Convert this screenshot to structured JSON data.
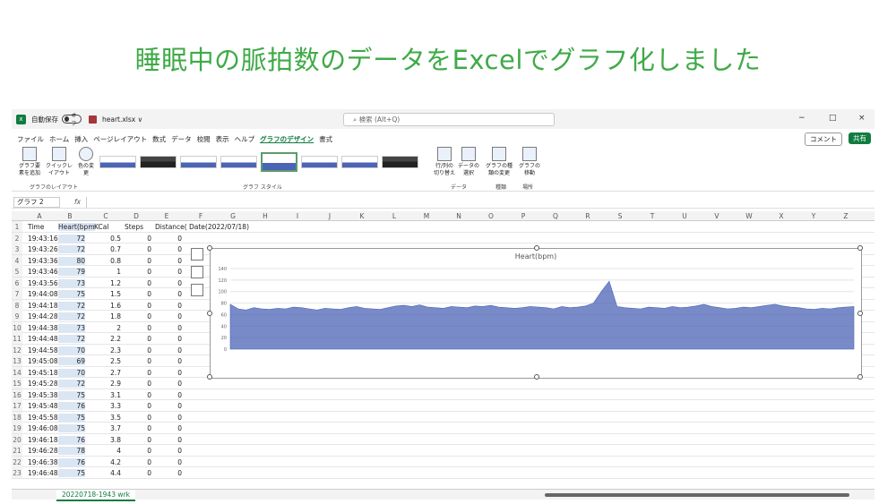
{
  "heading": "睡眠中の脈拍数のデータをExcelでグラフ化しました",
  "titlebar": {
    "autosave": "自動保存",
    "toggle": "オフ",
    "filename": "heart.xlsx ∨",
    "search": "検索 (Alt+Q)",
    "minimize": "−",
    "maximize": "□",
    "close": "×"
  },
  "menu": [
    "ファイル",
    "ホーム",
    "挿入",
    "ページレイアウト",
    "数式",
    "データ",
    "校閲",
    "表示",
    "ヘルプ",
    "グラフのデザイン",
    "書式"
  ],
  "buttons": {
    "comment": "コメント",
    "share": "共有"
  },
  "ribbon": {
    "add_element": "グラフ要素を追加",
    "quick_layout": "クイックレイアウト",
    "colors": "色の変更",
    "group_layout": "グラフのレイアウト",
    "group_style": "グラフ スタイル",
    "switch": "行/列の切り替え",
    "select_data": "データの選択",
    "group_data": "データ",
    "change_type": "グラフの種類の変更",
    "group_type": "種類",
    "move": "グラフの移動",
    "group_place": "場所"
  },
  "namebox": "グラフ 2",
  "columns": [
    "A",
    "B",
    "C",
    "D",
    "E",
    "F",
    "G",
    "H",
    "I",
    "J",
    "K",
    "L",
    "M",
    "N",
    "O",
    "P",
    "Q",
    "R",
    "S",
    "T",
    "U",
    "V",
    "W",
    "X",
    "Y",
    "Z"
  ],
  "header_row": [
    "Time",
    "Heart(bpm",
    "KCal",
    "Steps",
    "Distance(",
    "Date(2022/07/18)"
  ],
  "rows": [
    [
      "19:43:16",
      "72",
      "0.5",
      "0",
      "0"
    ],
    [
      "19:43:26",
      "72",
      "0.7",
      "0",
      "0"
    ],
    [
      "19:43:36",
      "80",
      "0.8",
      "0",
      "0"
    ],
    [
      "19:43:46",
      "79",
      "1",
      "0",
      "0"
    ],
    [
      "19:43:56",
      "73",
      "1.2",
      "0",
      "0"
    ],
    [
      "19:44:08",
      "75",
      "1.5",
      "0",
      "0"
    ],
    [
      "19:44:18",
      "72",
      "1.6",
      "0",
      "0"
    ],
    [
      "19:44:28",
      "72",
      "1.8",
      "0",
      "0"
    ],
    [
      "19:44:38",
      "73",
      "2",
      "0",
      "0"
    ],
    [
      "19:44:48",
      "72",
      "2.2",
      "0",
      "0"
    ],
    [
      "19:44:58",
      "70",
      "2.3",
      "0",
      "0"
    ],
    [
      "19:45:08",
      "69",
      "2.5",
      "0",
      "0"
    ],
    [
      "19:45:18",
      "70",
      "2.7",
      "0",
      "0"
    ],
    [
      "19:45:28",
      "72",
      "2.9",
      "0",
      "0"
    ],
    [
      "19:45:38",
      "75",
      "3.1",
      "0",
      "0"
    ],
    [
      "19:45:48",
      "76",
      "3.3",
      "0",
      "0"
    ],
    [
      "19:45:58",
      "75",
      "3.5",
      "0",
      "0"
    ],
    [
      "19:46:08",
      "75",
      "3.7",
      "0",
      "0"
    ],
    [
      "19:46:18",
      "76",
      "3.8",
      "0",
      "0"
    ],
    [
      "19:46:28",
      "78",
      "4",
      "0",
      "0"
    ],
    [
      "19:46:38",
      "76",
      "4.2",
      "0",
      "0"
    ],
    [
      "19:46:48",
      "75",
      "4.4",
      "0",
      "0"
    ]
  ],
  "sheet_tab": "20220718-1943 wrk",
  "chart_data": {
    "type": "area",
    "title": "Heart(bpm)",
    "ylim": [
      0,
      140
    ],
    "yticks": [
      0,
      20,
      40,
      60,
      80,
      100,
      120,
      140
    ],
    "values": [
      78,
      70,
      68,
      72,
      70,
      69,
      71,
      70,
      73,
      72,
      70,
      68,
      71,
      70,
      69,
      72,
      74,
      71,
      70,
      69,
      72,
      75,
      76,
      74,
      77,
      73,
      72,
      71,
      74,
      73,
      72,
      75,
      74,
      76,
      73,
      72,
      71,
      72,
      74,
      73,
      72,
      70,
      74,
      72,
      73,
      75,
      80,
      100,
      118,
      74,
      72,
      71,
      70,
      73,
      72,
      71,
      74,
      72,
      73,
      75,
      78,
      74,
      72,
      70,
      71,
      73,
      72,
      74,
      76,
      78,
      75,
      73,
      72,
      70,
      69,
      71,
      70,
      72,
      73,
      74
    ],
    "color": "#4b64b5"
  }
}
